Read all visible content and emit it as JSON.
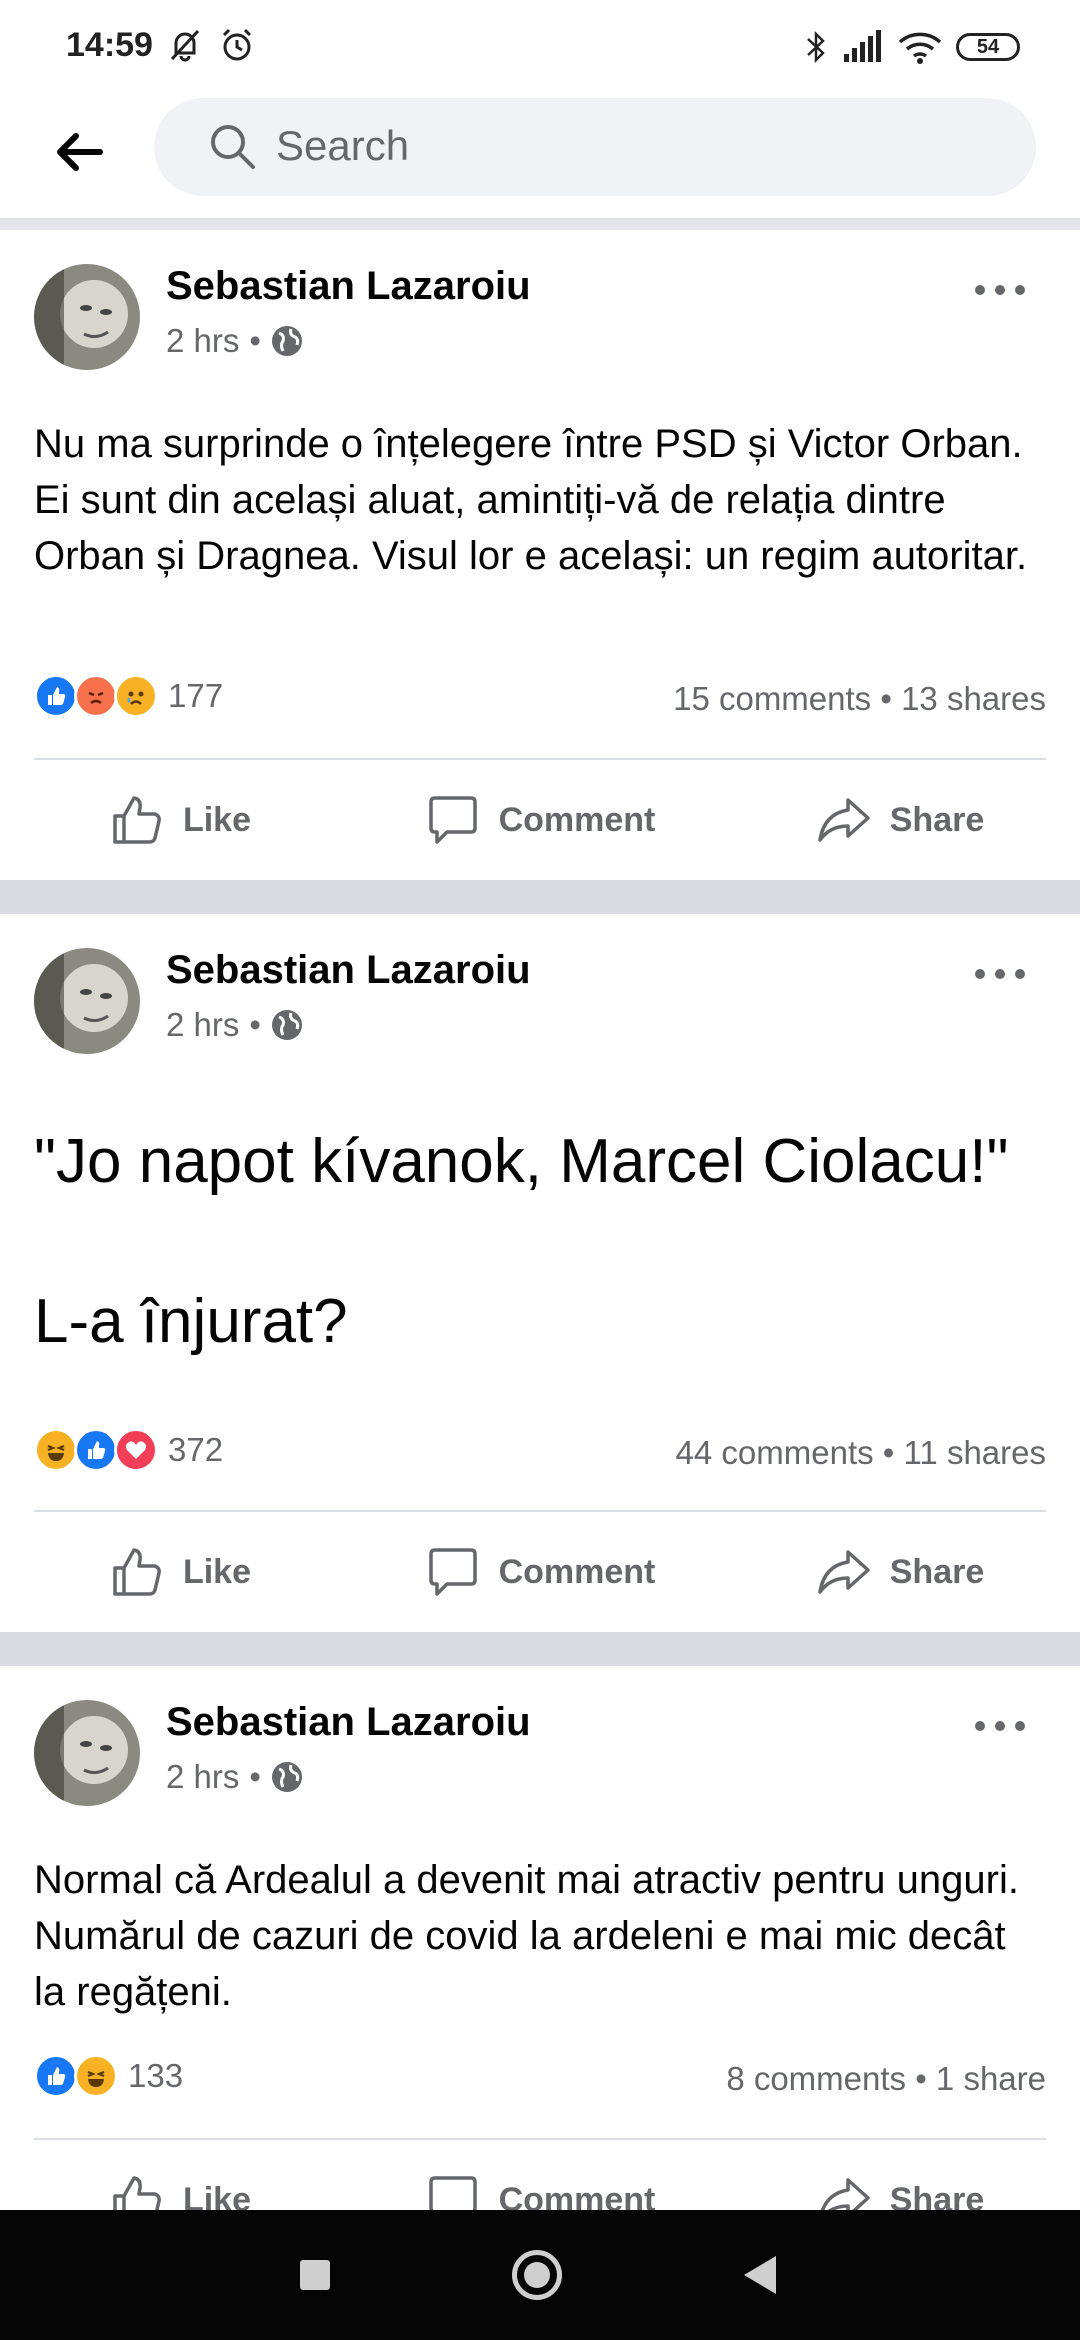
{
  "status_bar": {
    "time": "14:59",
    "battery": "54"
  },
  "header": {
    "search_placeholder": "Search"
  },
  "posts": [
    {
      "author": "Sebastian Lazaroiu",
      "time": "2 hrs",
      "text": "Nu ma surprinde o înțelegere între PSD și Victor Orban. Ei sunt din același aluat, amintiți-vă de relația dintre Orban și Dragnea. Visul lor e același: un regim autoritar.",
      "reactions": [
        "like",
        "angry",
        "sad"
      ],
      "reaction_count": "177",
      "stats": "15 comments • 13 shares"
    },
    {
      "author": "Sebastian Lazaroiu",
      "time": "2 hrs",
      "text_line1": "\"Jo napot kívanok, Marcel Ciolacu!\"",
      "text_line2": "L-a înjurat?",
      "reactions": [
        "haha",
        "like",
        "love"
      ],
      "reaction_count": "372",
      "stats": "44 comments • 11 shares"
    },
    {
      "author": "Sebastian Lazaroiu",
      "time": "2 hrs",
      "text": "Normal că Ardealul a devenit mai atractiv pentru unguri. Numărul de cazuri de covid la ardeleni e mai mic decât la regățeni.",
      "reactions": [
        "like",
        "haha"
      ],
      "reaction_count": "133",
      "stats": "8 comments • 1 share"
    }
  ],
  "actions": {
    "like": "Like",
    "comment": "Comment",
    "share": "Share"
  },
  "icons": {
    "back": "arrow-left-icon",
    "search": "search-icon",
    "globe": "globe-icon",
    "more": "more-horizontal-icon",
    "like": "thumbs-up-icon",
    "comment": "speech-bubble-icon",
    "share": "share-arrow-icon"
  },
  "colors": {
    "like_blue": "#1877f2",
    "angry_orange": "#f7714c",
    "sad_yellow": "#f7b125",
    "love_red": "#f33e58",
    "muted_text": "#65676b"
  }
}
